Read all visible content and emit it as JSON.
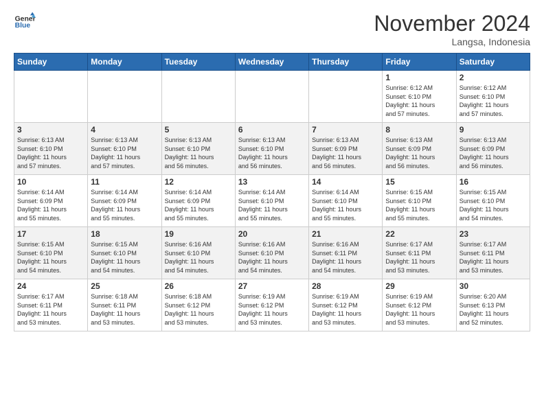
{
  "header": {
    "logo_line1": "General",
    "logo_line2": "Blue",
    "month": "November 2024",
    "location": "Langsa, Indonesia"
  },
  "weekdays": [
    "Sunday",
    "Monday",
    "Tuesday",
    "Wednesday",
    "Thursday",
    "Friday",
    "Saturday"
  ],
  "weeks": [
    [
      {
        "day": "",
        "info": ""
      },
      {
        "day": "",
        "info": ""
      },
      {
        "day": "",
        "info": ""
      },
      {
        "day": "",
        "info": ""
      },
      {
        "day": "",
        "info": ""
      },
      {
        "day": "1",
        "info": "Sunrise: 6:12 AM\nSunset: 6:10 PM\nDaylight: 11 hours\nand 57 minutes."
      },
      {
        "day": "2",
        "info": "Sunrise: 6:12 AM\nSunset: 6:10 PM\nDaylight: 11 hours\nand 57 minutes."
      }
    ],
    [
      {
        "day": "3",
        "info": "Sunrise: 6:13 AM\nSunset: 6:10 PM\nDaylight: 11 hours\nand 57 minutes."
      },
      {
        "day": "4",
        "info": "Sunrise: 6:13 AM\nSunset: 6:10 PM\nDaylight: 11 hours\nand 57 minutes."
      },
      {
        "day": "5",
        "info": "Sunrise: 6:13 AM\nSunset: 6:10 PM\nDaylight: 11 hours\nand 56 minutes."
      },
      {
        "day": "6",
        "info": "Sunrise: 6:13 AM\nSunset: 6:10 PM\nDaylight: 11 hours\nand 56 minutes."
      },
      {
        "day": "7",
        "info": "Sunrise: 6:13 AM\nSunset: 6:09 PM\nDaylight: 11 hours\nand 56 minutes."
      },
      {
        "day": "8",
        "info": "Sunrise: 6:13 AM\nSunset: 6:09 PM\nDaylight: 11 hours\nand 56 minutes."
      },
      {
        "day": "9",
        "info": "Sunrise: 6:13 AM\nSunset: 6:09 PM\nDaylight: 11 hours\nand 56 minutes."
      }
    ],
    [
      {
        "day": "10",
        "info": "Sunrise: 6:14 AM\nSunset: 6:09 PM\nDaylight: 11 hours\nand 55 minutes."
      },
      {
        "day": "11",
        "info": "Sunrise: 6:14 AM\nSunset: 6:09 PM\nDaylight: 11 hours\nand 55 minutes."
      },
      {
        "day": "12",
        "info": "Sunrise: 6:14 AM\nSunset: 6:09 PM\nDaylight: 11 hours\nand 55 minutes."
      },
      {
        "day": "13",
        "info": "Sunrise: 6:14 AM\nSunset: 6:10 PM\nDaylight: 11 hours\nand 55 minutes."
      },
      {
        "day": "14",
        "info": "Sunrise: 6:14 AM\nSunset: 6:10 PM\nDaylight: 11 hours\nand 55 minutes."
      },
      {
        "day": "15",
        "info": "Sunrise: 6:15 AM\nSunset: 6:10 PM\nDaylight: 11 hours\nand 55 minutes."
      },
      {
        "day": "16",
        "info": "Sunrise: 6:15 AM\nSunset: 6:10 PM\nDaylight: 11 hours\nand 54 minutes."
      }
    ],
    [
      {
        "day": "17",
        "info": "Sunrise: 6:15 AM\nSunset: 6:10 PM\nDaylight: 11 hours\nand 54 minutes."
      },
      {
        "day": "18",
        "info": "Sunrise: 6:15 AM\nSunset: 6:10 PM\nDaylight: 11 hours\nand 54 minutes."
      },
      {
        "day": "19",
        "info": "Sunrise: 6:16 AM\nSunset: 6:10 PM\nDaylight: 11 hours\nand 54 minutes."
      },
      {
        "day": "20",
        "info": "Sunrise: 6:16 AM\nSunset: 6:10 PM\nDaylight: 11 hours\nand 54 minutes."
      },
      {
        "day": "21",
        "info": "Sunrise: 6:16 AM\nSunset: 6:11 PM\nDaylight: 11 hours\nand 54 minutes."
      },
      {
        "day": "22",
        "info": "Sunrise: 6:17 AM\nSunset: 6:11 PM\nDaylight: 11 hours\nand 53 minutes."
      },
      {
        "day": "23",
        "info": "Sunrise: 6:17 AM\nSunset: 6:11 PM\nDaylight: 11 hours\nand 53 minutes."
      }
    ],
    [
      {
        "day": "24",
        "info": "Sunrise: 6:17 AM\nSunset: 6:11 PM\nDaylight: 11 hours\nand 53 minutes."
      },
      {
        "day": "25",
        "info": "Sunrise: 6:18 AM\nSunset: 6:11 PM\nDaylight: 11 hours\nand 53 minutes."
      },
      {
        "day": "26",
        "info": "Sunrise: 6:18 AM\nSunset: 6:12 PM\nDaylight: 11 hours\nand 53 minutes."
      },
      {
        "day": "27",
        "info": "Sunrise: 6:19 AM\nSunset: 6:12 PM\nDaylight: 11 hours\nand 53 minutes."
      },
      {
        "day": "28",
        "info": "Sunrise: 6:19 AM\nSunset: 6:12 PM\nDaylight: 11 hours\nand 53 minutes."
      },
      {
        "day": "29",
        "info": "Sunrise: 6:19 AM\nSunset: 6:12 PM\nDaylight: 11 hours\nand 53 minutes."
      },
      {
        "day": "30",
        "info": "Sunrise: 6:20 AM\nSunset: 6:13 PM\nDaylight: 11 hours\nand 52 minutes."
      }
    ]
  ]
}
